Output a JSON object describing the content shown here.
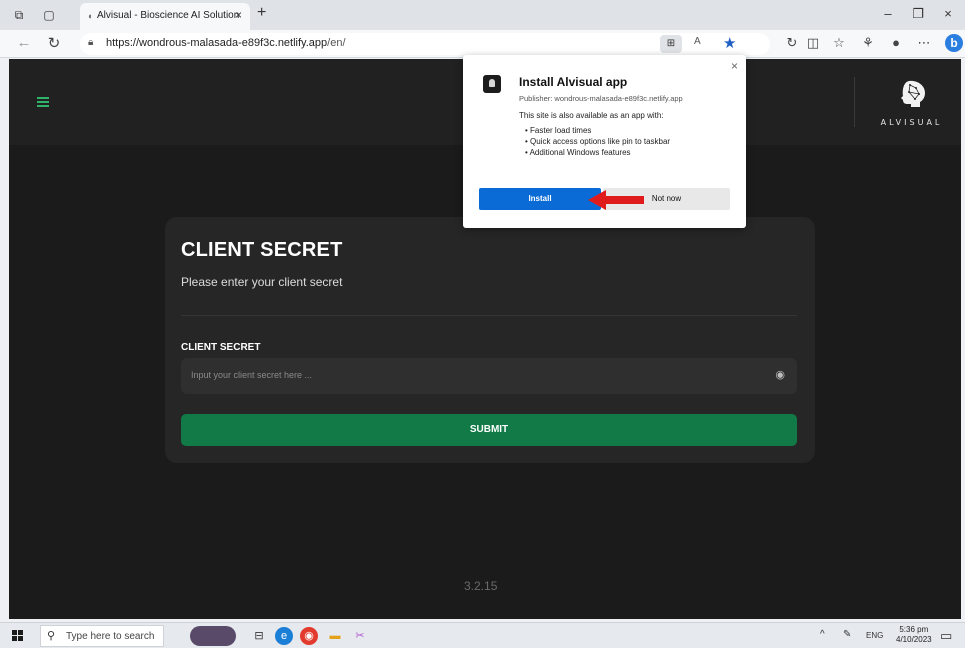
{
  "browser": {
    "tab_title": "Alvisual - Bioscience AI Solution",
    "tab_close": "×",
    "new_tab": "+",
    "url_host": "https://wondrous-malasada-e89f3c.netlify.app",
    "url_path": "/en/",
    "window_controls": [
      "–",
      "❐",
      "×"
    ]
  },
  "app": {
    "brand": "ALVISUAL",
    "card_title": "CLIENT SECRET",
    "card_subtitle": "Please enter your client secret",
    "field_label": "CLIENT SECRET",
    "field_placeholder": "Input your client secret here ...",
    "submit_label": "SUBMIT",
    "version": "3.2.15"
  },
  "popup": {
    "title": "Install Alvisual app",
    "publisher": "Publisher: wondrous-malasada-e89f3c.netlify.app",
    "available": "This site is also available as an app with:",
    "features": [
      "Faster load times",
      "Quick access options like pin to taskbar",
      "Additional Windows features"
    ],
    "install_label": "Install",
    "not_now_label": "Not now",
    "close": "×"
  },
  "taskbar": {
    "search_placeholder": "Type here to search",
    "language": "ENG",
    "time": "5:36 pm",
    "date": "4/10/2023"
  },
  "colors": {
    "accent_green": "#117a47",
    "install_blue": "#0a6bd6",
    "arrow_red": "#e01b1b"
  }
}
